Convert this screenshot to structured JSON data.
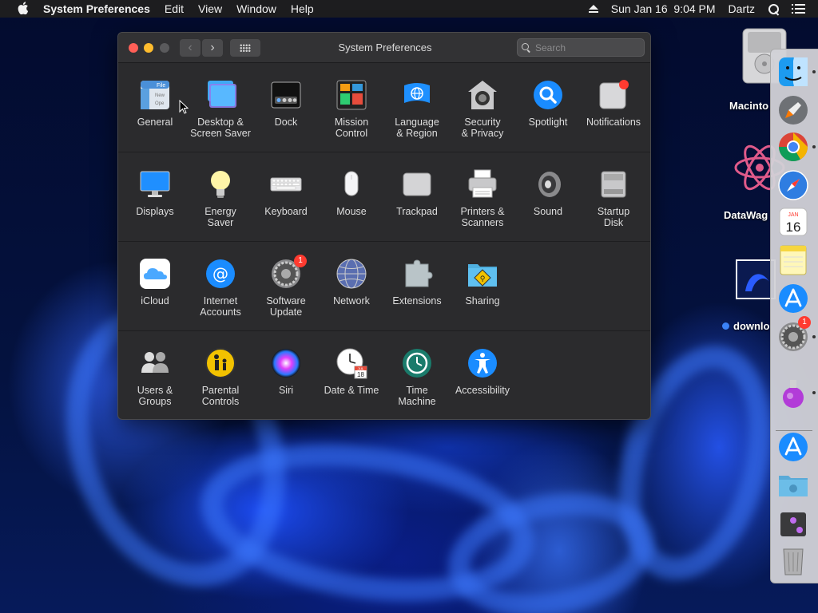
{
  "menubar": {
    "app_name": "System Preferences",
    "menus": [
      "Edit",
      "View",
      "Window",
      "Help"
    ],
    "clock": "Sun Jan 16  9:04 PM",
    "user": "Dartz"
  },
  "window": {
    "title": "System Preferences",
    "search_placeholder": "Search"
  },
  "sections": [
    [
      {
        "name": "general",
        "label": "General",
        "icon": "general-icon"
      },
      {
        "name": "desktop-screen-saver",
        "label": "Desktop &\nScreen Saver",
        "icon": "desktop-icon"
      },
      {
        "name": "dock",
        "label": "Dock",
        "icon": "dock-icon"
      },
      {
        "name": "mission-control",
        "label": "Mission\nControl",
        "icon": "mission-control-icon"
      },
      {
        "name": "language-region",
        "label": "Language\n& Region",
        "icon": "flag-icon"
      },
      {
        "name": "security-privacy",
        "label": "Security\n& Privacy",
        "icon": "house-lock-icon"
      },
      {
        "name": "spotlight",
        "label": "Spotlight",
        "icon": "magnifier-icon"
      },
      {
        "name": "notifications",
        "label": "Notifications",
        "icon": "notifications-icon"
      }
    ],
    [
      {
        "name": "displays",
        "label": "Displays",
        "icon": "monitor-icon"
      },
      {
        "name": "energy-saver",
        "label": "Energy\nSaver",
        "icon": "lightbulb-icon"
      },
      {
        "name": "keyboard",
        "label": "Keyboard",
        "icon": "keyboard-icon"
      },
      {
        "name": "mouse",
        "label": "Mouse",
        "icon": "mouse-icon"
      },
      {
        "name": "trackpad",
        "label": "Trackpad",
        "icon": "trackpad-icon"
      },
      {
        "name": "printers-scanners",
        "label": "Printers &\nScanners",
        "icon": "printer-icon"
      },
      {
        "name": "sound",
        "label": "Sound",
        "icon": "speaker-icon"
      },
      {
        "name": "startup-disk",
        "label": "Startup\nDisk",
        "icon": "disk-icon"
      }
    ],
    [
      {
        "name": "icloud",
        "label": "iCloud",
        "icon": "cloud-icon"
      },
      {
        "name": "internet-accounts",
        "label": "Internet\nAccounts",
        "icon": "at-sign-icon"
      },
      {
        "name": "software-update",
        "label": "Software\nUpdate",
        "icon": "gear-icon",
        "badge": "1"
      },
      {
        "name": "network",
        "label": "Network",
        "icon": "globe-icon"
      },
      {
        "name": "extensions",
        "label": "Extensions",
        "icon": "puzzle-icon"
      },
      {
        "name": "sharing",
        "label": "Sharing",
        "icon": "folder-sign-icon"
      }
    ],
    [
      {
        "name": "users-groups",
        "label": "Users &\nGroups",
        "icon": "users-icon"
      },
      {
        "name": "parental-controls",
        "label": "Parental\nControls",
        "icon": "parental-icon"
      },
      {
        "name": "siri",
        "label": "Siri",
        "icon": "siri-icon"
      },
      {
        "name": "date-time",
        "label": "Date & Time",
        "icon": "clock-calendar-icon",
        "calendar_day": "18",
        "calendar_month": "JUL"
      },
      {
        "name": "time-machine",
        "label": "Time\nMachine",
        "icon": "time-machine-icon"
      },
      {
        "name": "accessibility",
        "label": "Accessibility",
        "icon": "accessibility-icon"
      }
    ]
  ],
  "desktop": {
    "items": [
      {
        "label": "Macinto",
        "icon": "hard-drive-icon"
      },
      {
        "label": "DataWag",
        "icon": "atom-icon"
      },
      {
        "label": "downlo",
        "icon": "screenshot-file-icon"
      }
    ]
  },
  "dock": {
    "items": [
      {
        "name": "finder",
        "icon": "finder-icon",
        "running": true
      },
      {
        "name": "launchpad",
        "icon": "rocket-icon",
        "running": false
      },
      {
        "name": "chrome",
        "icon": "chrome-icon",
        "running": true
      },
      {
        "name": "safari",
        "icon": "compass-icon",
        "running": false
      },
      {
        "name": "calendar",
        "icon": "calendar-icon",
        "running": false,
        "month": "JAN",
        "day": "16"
      },
      {
        "name": "notes",
        "icon": "notes-icon",
        "running": false
      },
      {
        "name": "app-store",
        "icon": "app-store-icon",
        "running": false
      },
      {
        "name": "system-preferences",
        "icon": "gear-icon",
        "running": true,
        "badge": "1"
      },
      {
        "name": "installer",
        "icon": "potion-icon",
        "running": true
      },
      {
        "name": "app-store-2",
        "icon": "app-store-icon",
        "running": false
      },
      {
        "name": "downloads-folder",
        "icon": "folder-icon",
        "running": false
      },
      {
        "name": "recent-item",
        "icon": "stack-icon",
        "running": false
      },
      {
        "name": "trash",
        "icon": "trash-icon",
        "running": false
      }
    ]
  },
  "colors": {
    "menubar_bg": "#1d1d1f",
    "window_bg": "#2b2b2d",
    "accent_blue": "#0a84ff",
    "badge_red": "#ff3b30"
  }
}
